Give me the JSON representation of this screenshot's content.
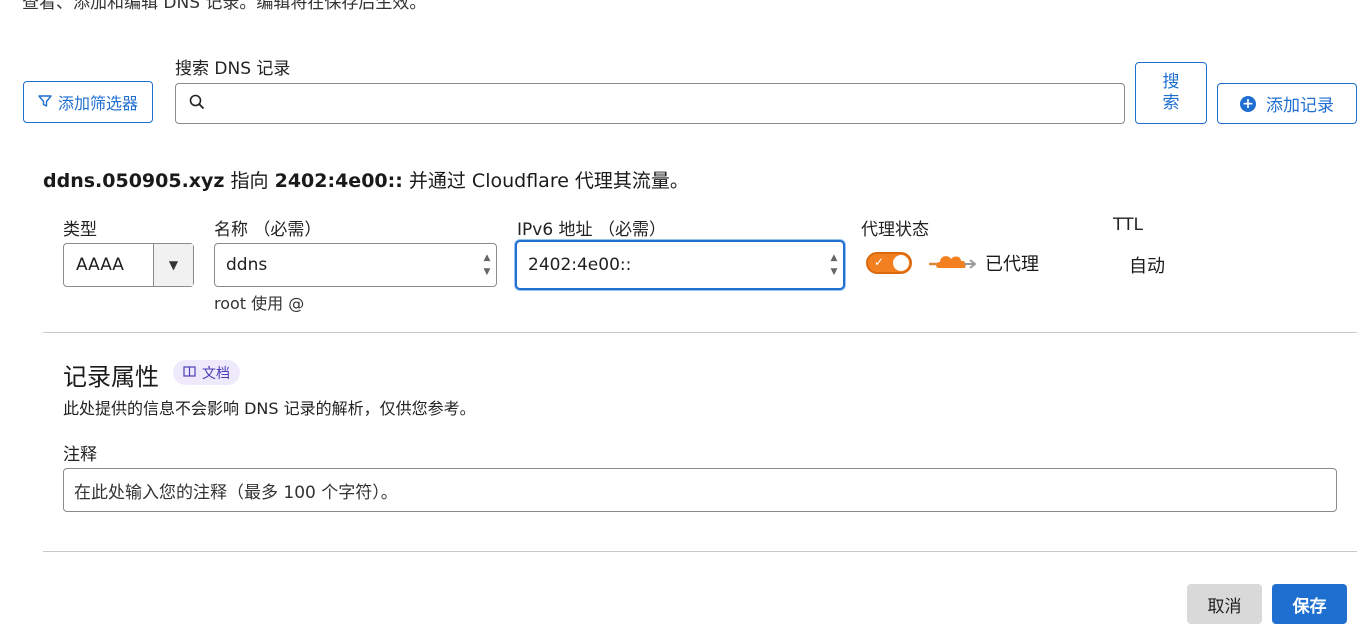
{
  "header": {
    "truncated_intro": "查看、添加和编辑 DNS 记录。编辑将在保存后生效。"
  },
  "toolbar": {
    "filter_label": "添加筛选器",
    "search_label": "搜索 DNS 记录",
    "search_value": "",
    "search_button_line1": "搜",
    "search_button_line2": "索",
    "add_record_label": "添加记录"
  },
  "summary": {
    "name": "ddns.050905.xyz",
    "points_to": "指向",
    "target": "2402:4e00::",
    "suffix": "并通过 Cloudflare 代理其流量。"
  },
  "form": {
    "type_label": "类型",
    "type_value": "AAAA",
    "name_label": "名称 （必需）",
    "name_value": "ddns",
    "name_hint": "root 使用 @",
    "ipv6_label": "IPv6 地址 （必需）",
    "ipv6_value": "2402:4e00::",
    "proxy_label": "代理状态",
    "proxy_status": "已代理",
    "ttl_label": "TTL",
    "ttl_value": "自动"
  },
  "attributes": {
    "title": "记录属性",
    "doc_badge": "文档",
    "description": "此处提供的信息不会影响 DNS 记录的解析，仅供您参考。",
    "comment_label": "注释",
    "comment_placeholder": "在此处输入您的注释（最多 100 个字符）。"
  },
  "actions": {
    "cancel": "取消",
    "save": "保存"
  },
  "colors": {
    "accent": "#1f6fd1",
    "proxy_orange": "#f38020"
  }
}
